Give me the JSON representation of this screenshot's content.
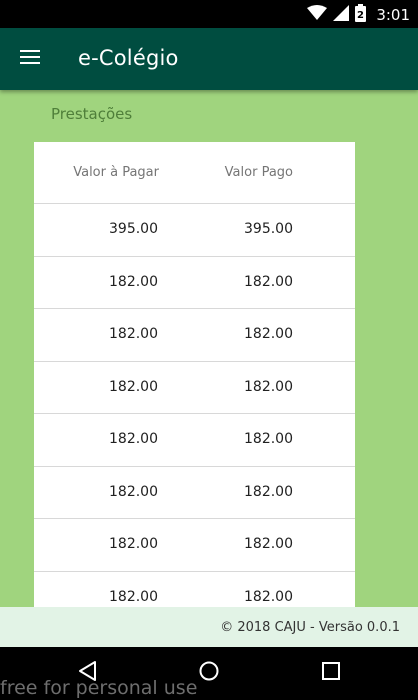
{
  "status_bar": {
    "time": "3:01",
    "icons": [
      "wifi-icon",
      "signal-icon",
      "battery-icon"
    ],
    "battery_level": "2"
  },
  "app_bar": {
    "title": "e-Colégio",
    "menu_icon": "hamburger-menu-icon"
  },
  "section": {
    "title": "Prestações"
  },
  "table": {
    "headers": [
      "Valor à Pagar",
      "Valor Pago"
    ],
    "rows": [
      [
        "395.00",
        "395.00"
      ],
      [
        "182.00",
        "182.00"
      ],
      [
        "182.00",
        "182.00"
      ],
      [
        "182.00",
        "182.00"
      ],
      [
        "182.00",
        "182.00"
      ],
      [
        "182.00",
        "182.00"
      ],
      [
        "182.00",
        "182.00"
      ],
      [
        "182.00",
        "182.00"
      ]
    ]
  },
  "footer": {
    "text": "© 2018 CAJU - Versão 0.0.1"
  },
  "nav_bar": {
    "buttons": [
      "back-icon",
      "home-icon",
      "recents-icon"
    ]
  },
  "watermark": "free for personal use",
  "colors": {
    "app_bar": "#004d40",
    "page_background": "#a0d47e",
    "section_title": "#4f7f3a",
    "footer_background": "#e2f3e6"
  }
}
